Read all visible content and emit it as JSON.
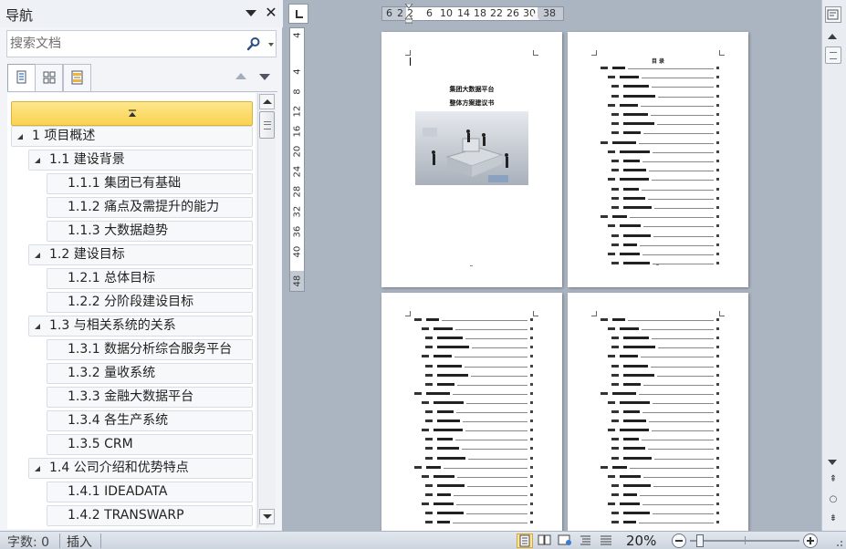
{
  "nav": {
    "title": "导航",
    "search_placeholder": "搜索文档",
    "tabs": [
      {
        "name": "headings",
        "icon": "document-outline-icon",
        "active": true
      },
      {
        "name": "pages",
        "icon": "page-thumbnails-icon",
        "active": false
      },
      {
        "name": "results",
        "icon": "search-results-icon",
        "active": false
      }
    ],
    "headings": [
      {
        "level": 1,
        "text": "1 项目概述"
      },
      {
        "level": 2,
        "text": "1.1 建设背景"
      },
      {
        "level": 3,
        "text": "1.1.1 集团已有基础"
      },
      {
        "level": 3,
        "text": "1.1.2 痛点及需提升的能力"
      },
      {
        "level": 3,
        "text": "1.1.3 大数据趋势"
      },
      {
        "level": 2,
        "text": "1.2 建设目标"
      },
      {
        "level": 3,
        "text": "1.2.1 总体目标"
      },
      {
        "level": 3,
        "text": "1.2.2 分阶段建设目标"
      },
      {
        "level": 2,
        "text": "1.3 与相关系统的关系"
      },
      {
        "level": 3,
        "text": "1.3.1 数据分析综合服务平台"
      },
      {
        "level": 3,
        "text": "1.3.2 量收系统"
      },
      {
        "level": 3,
        "text": "1.3.3 金融大数据平台"
      },
      {
        "level": 3,
        "text": "1.3.4 各生产系统"
      },
      {
        "level": 3,
        "text": "1.3.5 CRM"
      },
      {
        "level": 2,
        "text": "1.4 公司介绍和优势特点"
      },
      {
        "level": 3,
        "text": "1.4.1 IDEADATA"
      },
      {
        "level": 3,
        "text": "1.4.2 TRANSWARP"
      }
    ]
  },
  "ruler": {
    "horizontal_ticks": [
      "6",
      "2",
      "2",
      "6",
      "10",
      "14",
      "18",
      "22",
      "26",
      "30",
      "38"
    ],
    "vertical_ticks": [
      "4",
      "4",
      "8",
      "12",
      "16",
      "20",
      "24",
      "28",
      "32",
      "36",
      "40",
      "48"
    ]
  },
  "document": {
    "cover_title_line1": "集团大数据平台",
    "cover_title_line2": "整体方案建议书",
    "toc_title": "目 录"
  },
  "statusbar": {
    "word_count": "字数: 0",
    "insert_mode": "插入",
    "zoom": "20%"
  },
  "colors": {
    "accent_highlight": "#f9d24f",
    "workspace_bg": "#abb5c2",
    "pane_bg": "#f2f4f7"
  }
}
